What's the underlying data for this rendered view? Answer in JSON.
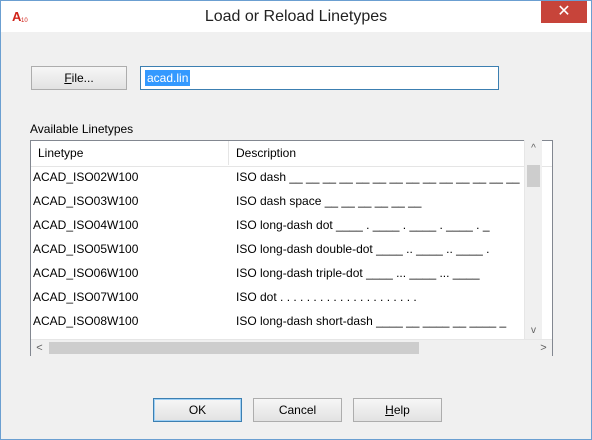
{
  "window": {
    "title": "Load or Reload Linetypes",
    "app_icon_text": "A10",
    "close_glyph": "✕"
  },
  "file": {
    "button_label_prefix": "F",
    "button_label_rest": "ile...",
    "value": "acad.lin"
  },
  "list": {
    "group_label": "Available Linetypes",
    "columns": [
      "Linetype",
      "Description"
    ],
    "rows": [
      {
        "linetype": "ACAD_ISO02W100",
        "description": "ISO dash __ __ __ __ __ __ __ __ __ __ __ __ __ __"
      },
      {
        "linetype": "ACAD_ISO03W100",
        "description": "ISO dash space __    __    __    __    __    __"
      },
      {
        "linetype": "ACAD_ISO04W100",
        "description": "ISO long-dash dot ____ . ____ . ____ . ____ . _"
      },
      {
        "linetype": "ACAD_ISO05W100",
        "description": "ISO long-dash double-dot ____ .. ____ .. ____ ."
      },
      {
        "linetype": "ACAD_ISO06W100",
        "description": "ISO long-dash triple-dot ____ ... ____ ... ____"
      },
      {
        "linetype": "ACAD_ISO07W100",
        "description": "ISO dot . . . . . . . . . . . . . . . . . . . . ."
      },
      {
        "linetype": "ACAD_ISO08W100",
        "description": "ISO long-dash short-dash ____ __ ____ __ ____ _"
      }
    ]
  },
  "scrollbar": {
    "up": "^",
    "down": "v",
    "left": "<",
    "right": ">"
  },
  "buttons": {
    "ok": "OK",
    "cancel": "Cancel",
    "help_prefix": "H",
    "help_rest": "elp"
  },
  "colors": {
    "accent": "#3399ff",
    "close": "#c7443a"
  }
}
